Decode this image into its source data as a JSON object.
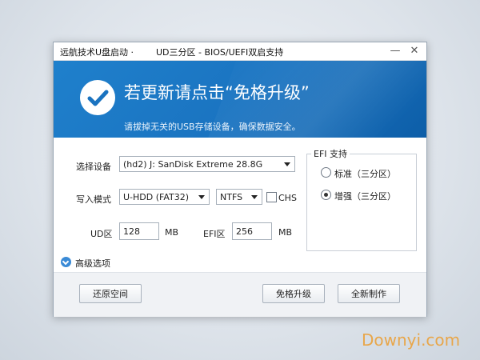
{
  "window": {
    "title_left": "远航技术U盘启动 ·",
    "title_right": "UD三分区 - BIOS/UEFI双启支持",
    "minimize_label": "—",
    "close_label": "✕"
  },
  "banner": {
    "title": "若更新请点击“免格升级”",
    "subtitle": "请拔掉无关的USB存储设备，确保数据安全。",
    "icon": "check-icon",
    "color": "#1a73c0"
  },
  "form": {
    "device_label": "选择设备",
    "device_value": "(hd2) J: SanDisk Extreme 28.8G",
    "mode_label": "写入模式",
    "mode_value": "U-HDD (FAT32)",
    "fs_value": "NTFS",
    "chs_label": "CHS",
    "ud_label": "UD区",
    "ud_value": "128",
    "ud_unit": "MB",
    "efi_label": "EFI区",
    "efi_value": "256",
    "efi_unit": "MB"
  },
  "efi_group": {
    "title": "EFI 支持",
    "options": [
      "标准（三分区）",
      "增强（三分区）"
    ],
    "selected": "增强（三分区）"
  },
  "advanced": {
    "label": "高级选项"
  },
  "buttons": {
    "restore": "还原空间",
    "upgrade": "免格升级",
    "create": "全新制作"
  },
  "watermark": "Downyi.com"
}
